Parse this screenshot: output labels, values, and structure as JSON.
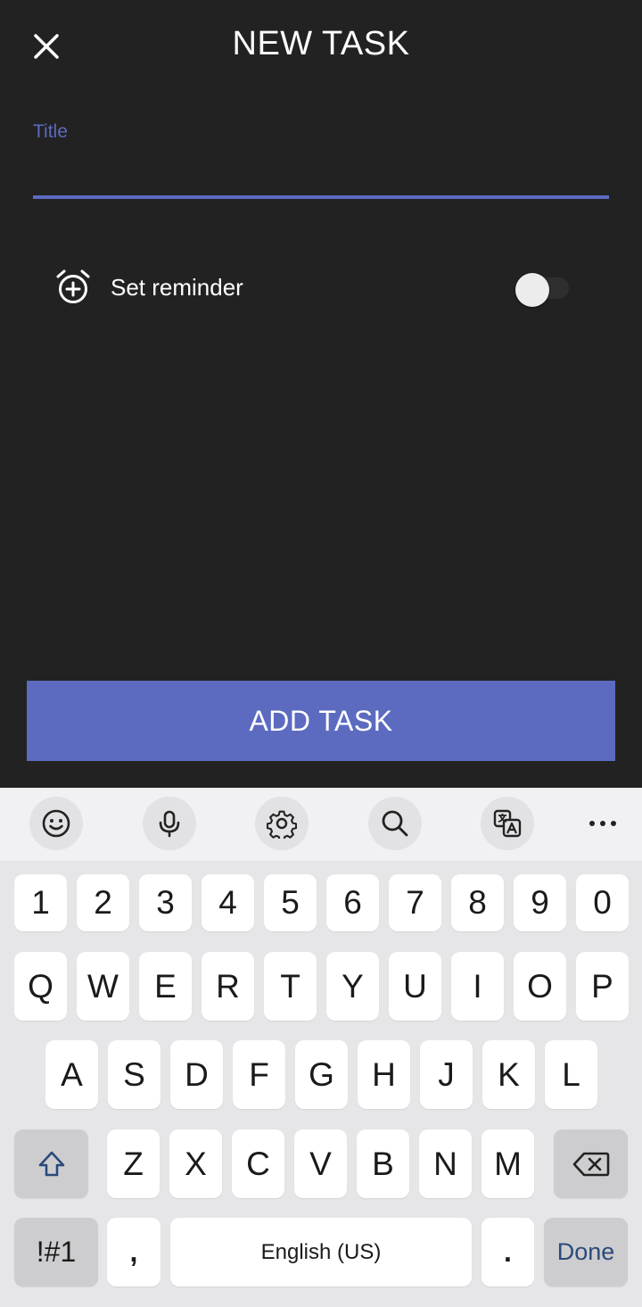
{
  "header": {
    "title": "NEW TASK"
  },
  "form": {
    "title_label": "Title",
    "title_value": ""
  },
  "reminder": {
    "label": "Set reminder",
    "enabled": false
  },
  "actions": {
    "add_task_label": "ADD TASK"
  },
  "theme": {
    "accent": "#5c6bc0",
    "background": "#222222"
  },
  "keyboard": {
    "toolbar_icons": [
      "emoji-icon",
      "microphone-icon",
      "settings-icon",
      "search-icon",
      "translate-icon",
      "more-icon"
    ],
    "row1": [
      "1",
      "2",
      "3",
      "4",
      "5",
      "6",
      "7",
      "8",
      "9",
      "0"
    ],
    "row2": [
      "Q",
      "W",
      "E",
      "R",
      "T",
      "Y",
      "U",
      "I",
      "O",
      "P"
    ],
    "row3": [
      "A",
      "S",
      "D",
      "F",
      "G",
      "H",
      "J",
      "K",
      "L"
    ],
    "row4": [
      "Z",
      "X",
      "C",
      "V",
      "B",
      "N",
      "M"
    ],
    "symbols_label": "!#1",
    "comma_label": ",",
    "space_label": "English (US)",
    "period_label": ".",
    "done_label": "Done"
  }
}
